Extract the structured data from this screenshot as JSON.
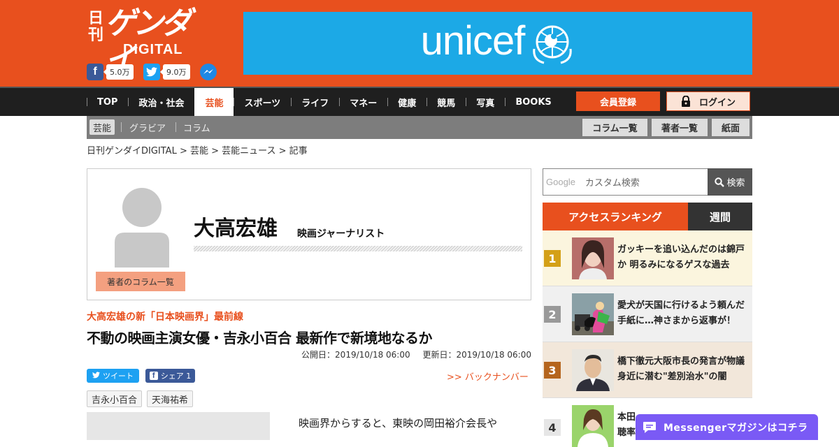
{
  "header": {
    "logo_nikkan": "日刊",
    "logo_gendai": "ゲンダイ",
    "logo_digital": "DIGITAL",
    "facebook_count": "5.0万",
    "twitter_count": "9.0万"
  },
  "ad": {
    "text": "unicef"
  },
  "nav": {
    "items": [
      "TOP",
      "政治・社会",
      "芸能",
      "スポーツ",
      "ライフ",
      "マネー",
      "健康",
      "競馬",
      "写真",
      "BOOKS"
    ],
    "active": "芸能",
    "register_label": "会員登録",
    "login_label": "ログイン"
  },
  "subnav": {
    "items": [
      "芸能",
      "グラビア",
      "コラム"
    ],
    "buttons": [
      "コラム一覧",
      "著者一覧",
      "紙面"
    ]
  },
  "breadcrumb": "日刊ゲンダイDIGITAL > 芸能 > 芸能ニュース > 記事",
  "author": {
    "name": "大高宏雄",
    "role": "映画ジャーナリスト",
    "columns_button": "著者のコラム一覧"
  },
  "article": {
    "series": "大高宏雄の新「日本映画界」最前線",
    "title": "不動の映画主演女優・吉永小百合 最新作で新境地なるか",
    "published": "公開日：2019/10/18 06:00",
    "updated": "更新日：2019/10/18 06:00",
    "tweet_label": "ツイート",
    "share_label": "シェア 1",
    "backnumber": ">> バックナンバー",
    "tags": [
      "吉永小百合",
      "天海祐希"
    ],
    "body": "映画界からすると、東映の岡田裕介会長や"
  },
  "search": {
    "google_label": "Google",
    "placeholder": "カスタム検索",
    "button": "検索"
  },
  "ranking": {
    "title": "アクセスランキング",
    "period": "週間",
    "items": [
      {
        "rank": "1",
        "text": "ガッキーを追い込んだのは錦戸か 明るみになるゲスな過去"
      },
      {
        "rank": "2",
        "text": "愛犬が天国に行けるよう頼んだ手紙に…神さまから返事が！"
      },
      {
        "rank": "3",
        "text": "橋下徹元大阪市長の発言が物議 身近に潜む\"差別治水\"の闇"
      },
      {
        "rank": "4",
        "text": "本田\n聴率"
      }
    ]
  },
  "messenger_banner": "Messengerマガジンはコチラ",
  "colors": {
    "brand": "#e8501e",
    "nav_bg": "#1f1f1f",
    "subnav_bg": "#7d7d7d",
    "rank1": "#d4a017",
    "rank2": "#999999",
    "rank3": "#b5651d",
    "messenger": "#7a5af5"
  }
}
